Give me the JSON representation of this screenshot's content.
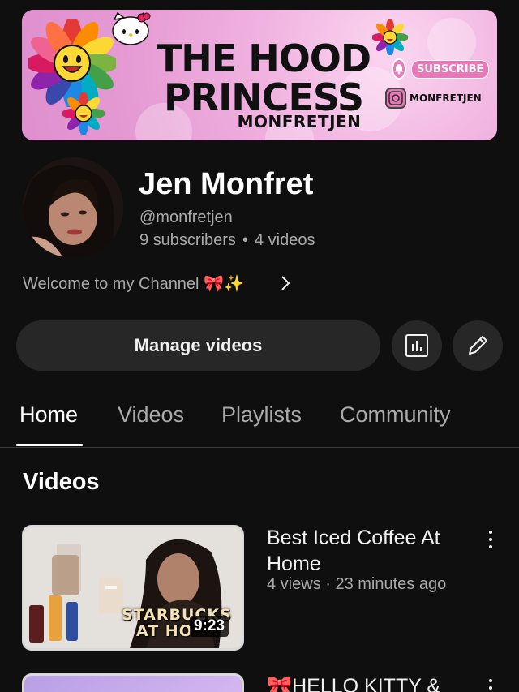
{
  "banner": {
    "title_line1": "THE HOOD",
    "title_line2": "PRINCESS",
    "subtitle": "MONFRETJEN",
    "subscribe_label": "SUBSCRIBE",
    "instagram_handle": "MONFRETJEN"
  },
  "channel": {
    "name": "Jen Monfret",
    "handle": "@monfretjen",
    "subscribers": "9 subscribers",
    "separator": "•",
    "videos_count": "4 videos",
    "description": "Welcome to my Channel 🎀✨"
  },
  "actions": {
    "manage_label": "Manage videos",
    "analytics_icon": "analytics-icon",
    "edit_icon": "pencil-icon"
  },
  "tabs": [
    {
      "label": "Home",
      "active": true
    },
    {
      "label": "Videos",
      "active": false
    },
    {
      "label": "Playlists",
      "active": false
    },
    {
      "label": "Community",
      "active": false
    }
  ],
  "section": {
    "title": "Videos"
  },
  "videos": [
    {
      "title": "Best Iced Coffee At Home",
      "meta": "4 views · 23 minutes ago",
      "duration": "9:23",
      "thumbnail_text_line1": "STARBUCKS",
      "thumbnail_text_line2": "AT HO"
    },
    {
      "title": "🎀HELLO KITTY &"
    }
  ],
  "colors": {
    "background": "#0f0f0f",
    "button_bg": "#272727",
    "secondary_text": "#aaaaaa",
    "banner_pink": "#e59ad3"
  }
}
